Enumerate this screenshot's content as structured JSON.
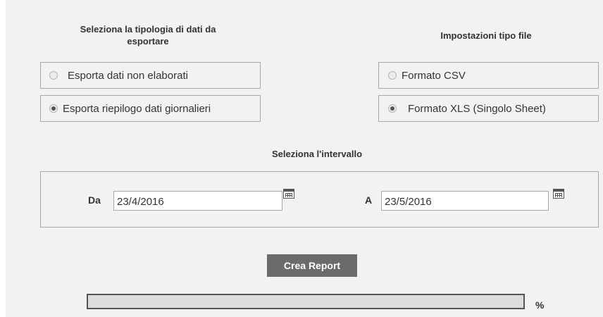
{
  "export_type": {
    "heading": "Seleziona la tipologia di dati da esportare",
    "options": [
      {
        "label": "Esporta dati non elaborati",
        "checked": false
      },
      {
        "label": "Esporta riepilogo dati giornalieri",
        "checked": true
      }
    ]
  },
  "file_type": {
    "heading": "Impostazioni tipo file",
    "options": [
      {
        "label": "Formato CSV",
        "checked": false
      },
      {
        "label": "Formato XLS (Singolo Sheet)",
        "checked": true
      }
    ]
  },
  "interval": {
    "heading": "Seleziona l'intervallo",
    "from_label": "Da",
    "from_value": "23/4/2016",
    "to_label": "A",
    "to_value": "23/5/2016",
    "calendar_icon": "calendar-icon"
  },
  "actions": {
    "create_report_label": "Crea Report"
  },
  "progress": {
    "value_percent": 0,
    "unit_label": "%"
  }
}
